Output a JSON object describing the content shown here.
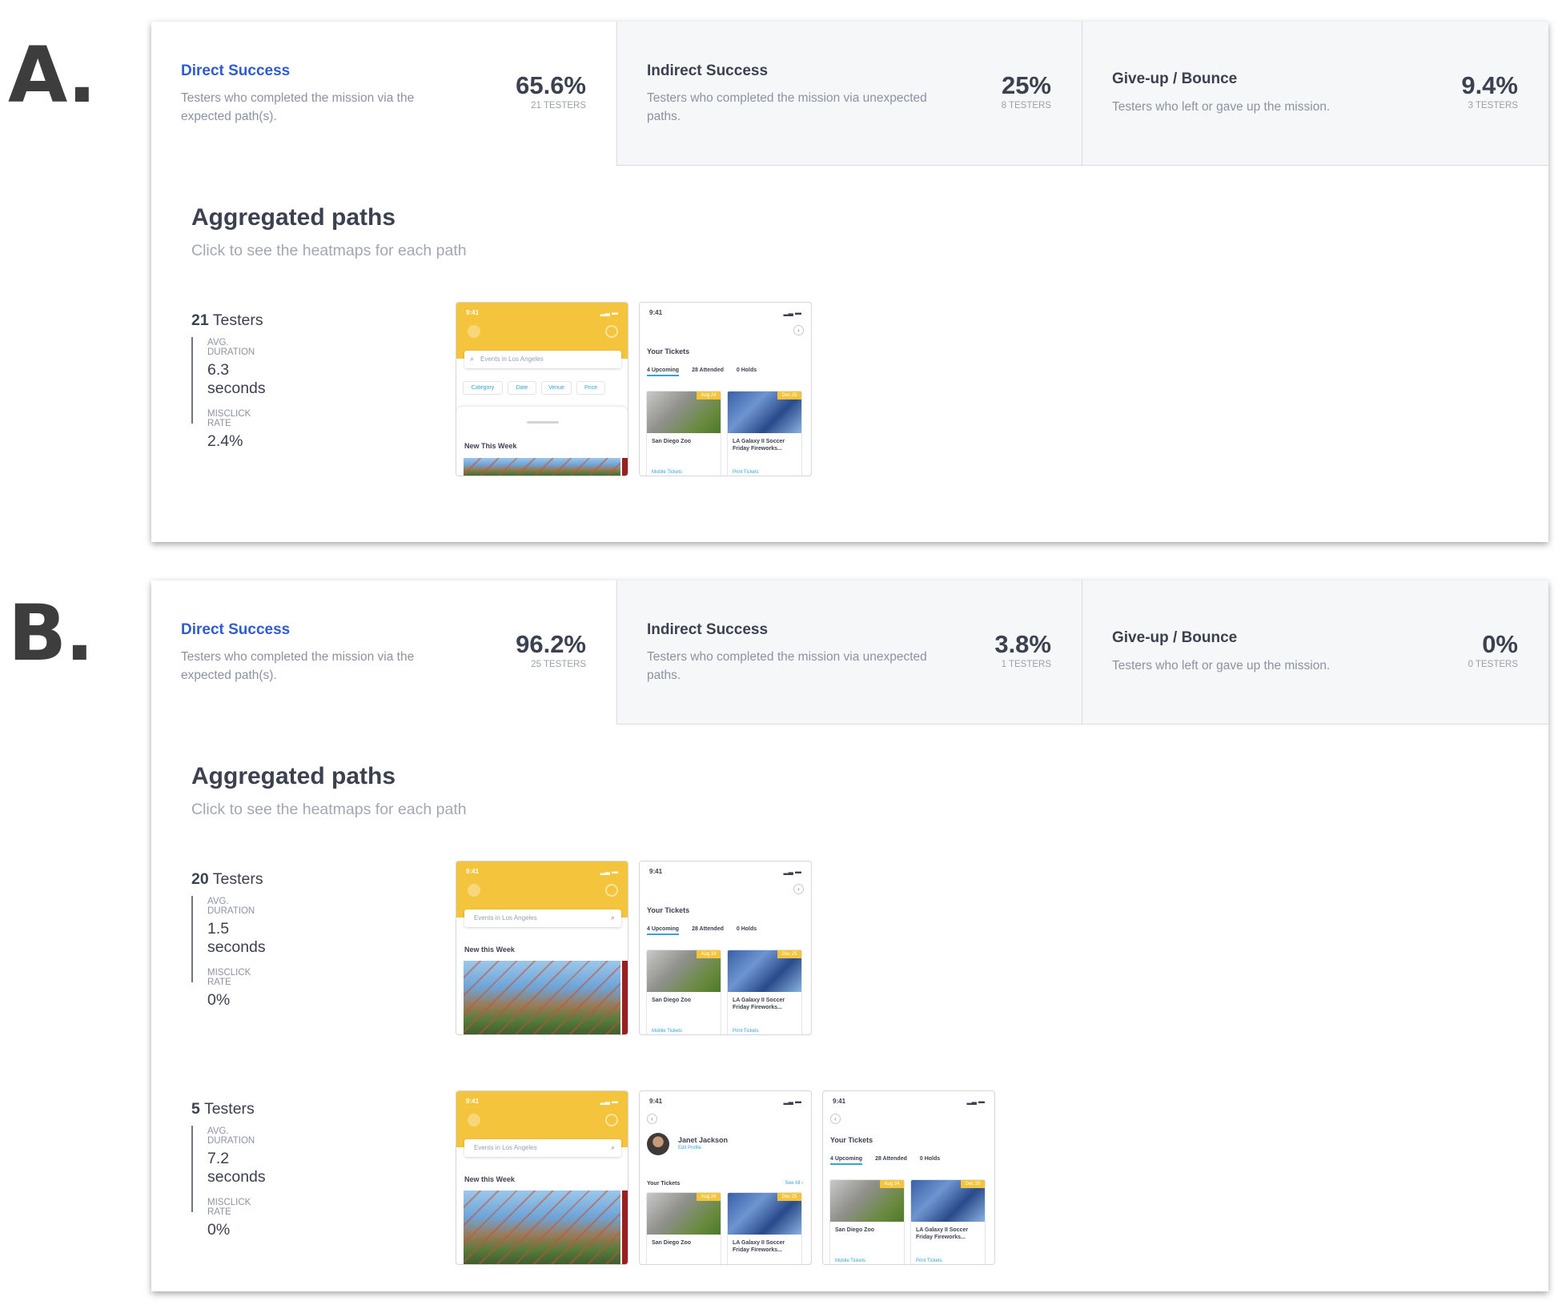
{
  "labels": {
    "a": "A.",
    "b": "B."
  },
  "panels": {
    "a": {
      "stats": [
        {
          "title": "Direct Success",
          "desc": "Testers who completed the mission via the expected path(s).",
          "pct": "65.6%",
          "testers": "21 TESTERS"
        },
        {
          "title": "Indirect Success",
          "desc": "Testers who completed the mission via unexpected paths.",
          "pct": "25%",
          "testers": "8 TESTERS"
        },
        {
          "title": "Give-up / Bounce",
          "desc": "Testers who left or gave up the mission.",
          "pct": "9.4%",
          "testers": "3 TESTERS"
        }
      ],
      "agg_title": "Aggregated paths",
      "agg_sub": "Click to see the heatmaps for each path",
      "paths": [
        {
          "count": "21",
          "count_label": "Testers",
          "dur_label": "AVG. DURATION",
          "duration": "6.3 seconds",
          "mis_label": "MISCLICK RATE",
          "misclick": "2.4%"
        }
      ]
    },
    "b": {
      "stats": [
        {
          "title": "Direct Success",
          "desc": "Testers who completed the mission via the expected path(s).",
          "pct": "96.2%",
          "testers": "25 TESTERS"
        },
        {
          "title": "Indirect Success",
          "desc": "Testers who completed the mission via unexpected paths.",
          "pct": "3.8%",
          "testers": "1 TESTERS"
        },
        {
          "title": "Give-up / Bounce",
          "desc": "Testers who left or gave up the mission.",
          "pct": "0%",
          "testers": "0 TESTERS"
        }
      ],
      "agg_title": "Aggregated paths",
      "agg_sub": "Click to see the heatmaps for each path",
      "paths": [
        {
          "count": "20",
          "count_label": "Testers",
          "dur_label": "AVG. DURATION",
          "duration": "1.5 seconds",
          "mis_label": "MISCLICK RATE",
          "misclick": "0%"
        },
        {
          "count": "5",
          "count_label": "Testers",
          "dur_label": "AVG. DURATION",
          "duration": "7.2 seconds",
          "mis_label": "MISCLICK RATE",
          "misclick": "0%"
        }
      ]
    }
  },
  "screens": {
    "time": "9:41",
    "search_placeholder": "Events in Los Angeles",
    "chips": [
      "Category",
      "Date",
      "Venue",
      "Price"
    ],
    "new_this_week_a": "New This Week",
    "new_this_week_b": "New this Week",
    "your_tickets": "Your Tickets",
    "tabs": [
      "4 Upcoming",
      "28 Attended",
      "0 Holds"
    ],
    "card1_tag": "Aug 24",
    "card1_title": "San Diego Zoo",
    "card1_link": "Mobile Tickets",
    "card2_tag": "Dec 25",
    "card2_title": "LA Galaxy II Soccer Friday Fireworks...",
    "card2_link": "Print Tickets",
    "profile_name": "Janet Jackson",
    "profile_edit": "Edit Profile",
    "see_all": "See All",
    "accent_yellow": "#f4c43c",
    "accent_blue": "#36a3d8"
  },
  "colors": {
    "direct_title": "#2f5bd3",
    "text_dark": "#3c4150",
    "text_muted": "#8c93a0"
  }
}
